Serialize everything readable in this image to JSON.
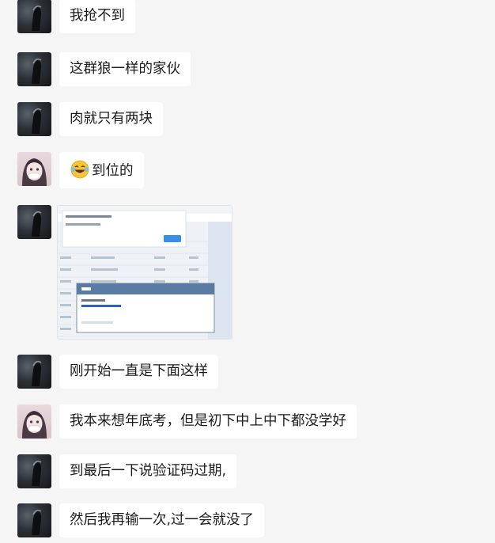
{
  "messages": [
    {
      "sender": "dark",
      "text": "我抢不到"
    },
    {
      "sender": "dark",
      "text": "这群狼一样的家伙"
    },
    {
      "sender": "dark",
      "text": "肉就只有两块"
    },
    {
      "sender": "girl",
      "emoji": "laughing-tears",
      "text": "到位的"
    },
    {
      "sender": "dark",
      "image": "screenshot-thumbnail"
    },
    {
      "sender": "dark",
      "text": "刚开始一直是下面这样"
    },
    {
      "sender": "girl",
      "text": "我本来想年底考，但是初下中上中下都没学好"
    },
    {
      "sender": "dark",
      "text": "到最后一下说验证码过期,"
    },
    {
      "sender": "dark",
      "text": "然后我再输一次,过一会就没了"
    }
  ],
  "colors": {
    "background": "#f5f5f5",
    "bubble": "#ffffff",
    "text": "#1b1b1b",
    "dialog_header": "#5a7ca3",
    "dialog_button": "#3a8ee6"
  }
}
